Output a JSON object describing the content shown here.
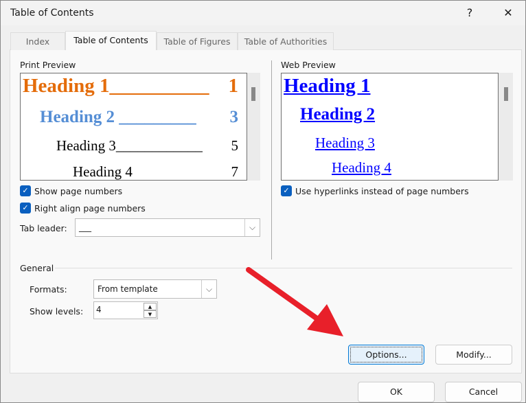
{
  "window": {
    "title": "Table of Contents",
    "help": "?",
    "close": "✕"
  },
  "tabs": [
    {
      "label": "Index"
    },
    {
      "label": "Table of Contents"
    },
    {
      "label": "Table of Figures"
    },
    {
      "label": "Table of Authorities"
    }
  ],
  "print_preview": {
    "label": "Print Preview",
    "lines": [
      {
        "text": "Heading 1",
        "leader": "__________",
        "page": "1",
        "color": "#e46c0a"
      },
      {
        "text": "Heading 2",
        "leader": "_________",
        "page": "3",
        "color": "#558ed5"
      },
      {
        "text": "Heading 3",
        "leader": "____________",
        "page": "5",
        "color": "#000000"
      },
      {
        "text": "Heading 4",
        "leader": "",
        "page": "7",
        "color": "#000000"
      }
    ]
  },
  "web_preview": {
    "label": "Web Preview",
    "lines": [
      "Heading 1",
      "Heading 2",
      "Heading 3",
      "Heading 4"
    ],
    "link_color": "#0000ff"
  },
  "options": {
    "show_page_numbers": {
      "label": "Show page numbers",
      "checked": true
    },
    "right_align": {
      "label": "Right align page numbers",
      "checked": true
    },
    "use_hyperlinks": {
      "label": "Use hyperlinks instead of page numbers",
      "checked": true
    },
    "tab_leader": {
      "label": "Tab leader:",
      "value": "___"
    }
  },
  "general": {
    "label": "General",
    "formats": {
      "label": "Formats:",
      "value": "From template"
    },
    "show_levels": {
      "label": "Show levels:",
      "value": "4"
    }
  },
  "buttons": {
    "options": "Options...",
    "modify": "Modify...",
    "ok": "OK",
    "cancel": "Cancel"
  },
  "colors": {
    "accent": "#0a5fbf",
    "arrow": "#e8202a"
  }
}
